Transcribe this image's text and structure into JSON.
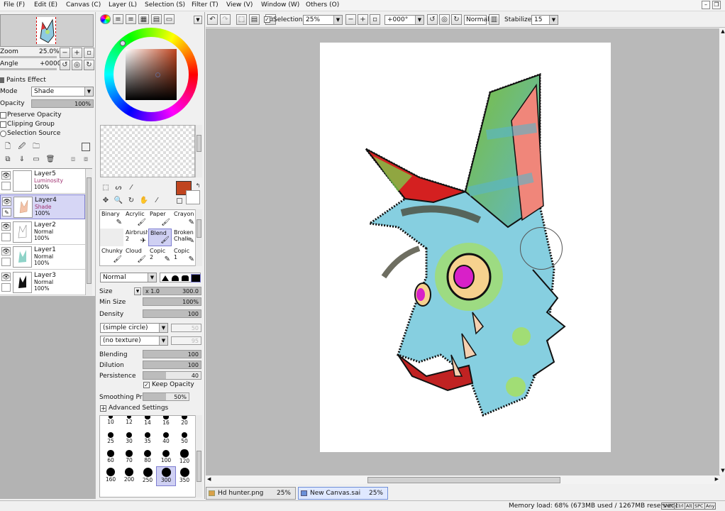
{
  "menu": [
    "File (F)",
    "Edit (E)",
    "Canvas (C)",
    "Layer (L)",
    "Selection (S)",
    "Filter (T)",
    "View (V)",
    "Window (W)",
    "Others (O)"
  ],
  "navigator": {
    "zoom_label": "Zoom",
    "zoom_value": "25.0%",
    "angle_label": "Angle",
    "angle_value": "+0000"
  },
  "layer_props": {
    "paints_effect": "Paints Effect",
    "mode_label": "Mode",
    "mode_value": "Shade",
    "opacity_label": "Opacity",
    "opacity_value": "100%",
    "preserve_opacity": "Preserve Opacity",
    "clipping_group": "Clipping Group",
    "selection_source": "Selection Source"
  },
  "layers": [
    {
      "name": "Layer5",
      "mode": "Luminosity",
      "opacity": "100%",
      "active": false
    },
    {
      "name": "Layer4",
      "mode": "Shade",
      "opacity": "100%",
      "active": true
    },
    {
      "name": "Layer2",
      "mode": "Normal",
      "opacity": "100%",
      "active": false
    },
    {
      "name": "Layer1",
      "mode": "Normal",
      "opacity": "100%",
      "active": false
    },
    {
      "name": "Layer3",
      "mode": "Normal",
      "opacity": "100%",
      "active": false
    }
  ],
  "colors": {
    "primary": "#c0451f",
    "secondary": "#ffffff",
    "selection_accent": "#7d7dd0"
  },
  "brush_tools": [
    [
      {
        "name": "Binary",
        "sub": ""
      },
      {
        "name": "Acrylic",
        "sub": ""
      },
      {
        "name": "Paper",
        "sub": ""
      },
      {
        "name": "Crayon",
        "sub": ""
      }
    ],
    [
      {
        "name": "",
        "sub": ""
      },
      {
        "name": "Airbrush",
        "sub": "2"
      },
      {
        "name": "Blend",
        "sub": ""
      },
      {
        "name": "Broken",
        "sub": "Chalk"
      }
    ],
    [
      {
        "name": "Chunky",
        "sub": ""
      },
      {
        "name": "Cloud",
        "sub": ""
      },
      {
        "name": "Copic",
        "sub": "2"
      },
      {
        "name": "Copic",
        "sub": "1"
      }
    ]
  ],
  "brush": {
    "blend_mode": "Normal",
    "size_label": "Size",
    "size_mult": "x 1.0",
    "size_value": "300.0",
    "min_size_label": "Min Size",
    "min_size_value": "100%",
    "density_label": "Density",
    "density_value": "100",
    "shape": "(simple circle)",
    "shape_value": "50",
    "texture": "(no texture)",
    "texture_value": "95",
    "blending_label": "Blending",
    "blending_value": "100",
    "dilution_label": "Dilution",
    "dilution_value": "100",
    "persistence_label": "Persistence",
    "persistence_value": "40",
    "keep_opacity": "Keep Opacity",
    "smoothing_label": "Smoothing Prs",
    "smoothing_value": "50%",
    "advanced": "Advanced Settings"
  },
  "brush_sizes": [
    "10",
    "12",
    "14",
    "16",
    "20",
    "25",
    "30",
    "35",
    "40",
    "50",
    "60",
    "70",
    "80",
    "100",
    "120",
    "160",
    "200",
    "250",
    "300",
    "350"
  ],
  "toolbar": {
    "selection_label": "Selection",
    "zoom_value": "25%",
    "angle_value": "+000°",
    "mode_value": "Normal",
    "stabilizer_label": "Stabilizer",
    "stabilizer_value": "15"
  },
  "tabs": [
    {
      "name": "Hd hunter.png",
      "zoom": "25%"
    },
    {
      "name": "New Canvas.sai",
      "zoom": "25%"
    }
  ],
  "status": {
    "memory": "Memory load: 68% (673MB used / 1267MB reserved)",
    "keys": [
      "Shift",
      "Ctrl",
      "Alt",
      "SPC",
      "Any"
    ]
  }
}
